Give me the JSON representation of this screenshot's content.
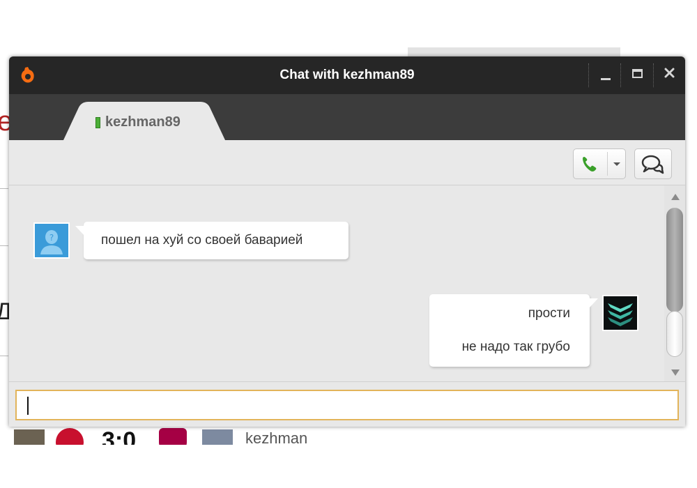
{
  "window": {
    "title": "Chat with kezhman89",
    "controls": {
      "minimize_icon": "minimize-icon",
      "maximize_icon": "maximize-icon",
      "close_icon": "close-icon"
    }
  },
  "tab": {
    "label": "kezhman89",
    "status_color": "#4caf37"
  },
  "toolbar": {
    "call_icon": "phone-icon",
    "call_dropdown_icon": "caret-down-icon",
    "chat_icon": "chat-bubbles-icon"
  },
  "messages": [
    {
      "side": "left",
      "avatar": "default-user-avatar",
      "lines": [
        "пошел на хуй со своей баварией"
      ]
    },
    {
      "side": "right",
      "avatar": "user-avatar-emblem",
      "lines": [
        "прости",
        "не надо так грубо"
      ]
    }
  ],
  "input": {
    "value": "",
    "placeholder": ""
  },
  "background": {
    "score": "3:0",
    "username": "kezhman"
  },
  "colors": {
    "titlebar": "#262626",
    "tabbar": "#3c3c3c",
    "accent_orange": "#f56c12",
    "input_border": "#e2b45a",
    "call_green": "#3aa02a"
  }
}
